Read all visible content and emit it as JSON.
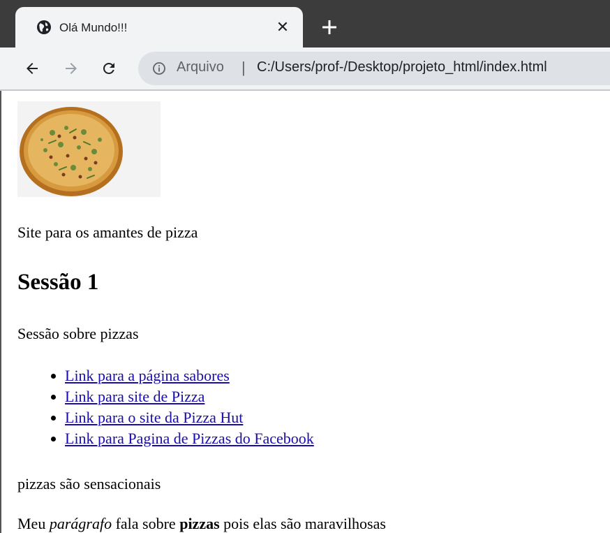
{
  "browser": {
    "tab": {
      "title": "Olá Mundo!!!",
      "favicon": "globe-icon",
      "close_icon": "close-icon"
    },
    "new_tab_icon": "plus-icon",
    "toolbar": {
      "back_icon": "back-arrow-icon",
      "forward_icon": "forward-arrow-icon",
      "reload_icon": "reload-icon",
      "info_icon": "info-icon",
      "origin_label": "Arquivo",
      "separator": "|",
      "url": "C:/Users/prof-/Desktop/projeto_html/index.html"
    }
  },
  "page": {
    "image": "pizza-image",
    "intro": "Site para os amantes de pizza",
    "section_heading": "Sessão 1",
    "section_text": "Sessão sobre pizzas",
    "links": [
      "Link para a página sabores",
      "Link para site de Pizza",
      "Link para o site da Pizza Hut",
      "Link para Pagina de Pizzas do Facebook"
    ],
    "pizzas_text": "pizzas são sensacionais",
    "paragraph": {
      "part1": "Meu ",
      "em": "parágrafo",
      "part2": " fala sobre ",
      "strong": "pizzas",
      "part3": " pois elas são maravilhosas"
    }
  },
  "colors": {
    "link": "#1a0dab",
    "tabstrip": "#3c3c3c",
    "toolbar": "#f1f3f4",
    "omnibox": "#dee1e6"
  }
}
